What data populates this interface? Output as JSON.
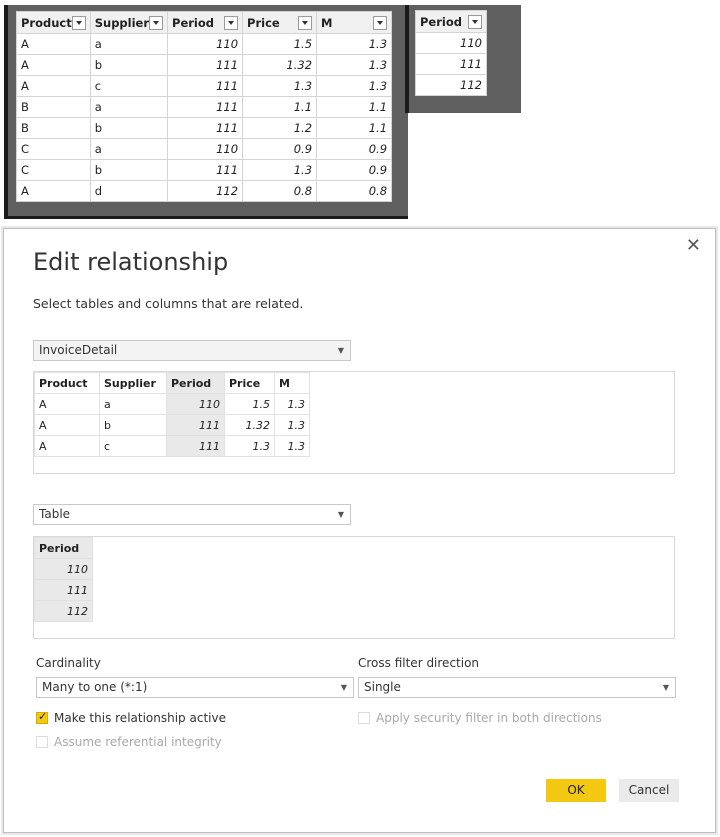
{
  "grid_left": {
    "columns": [
      "Product",
      "Supplier",
      "Period",
      "Price",
      "M"
    ],
    "rows": [
      [
        "A",
        "a",
        "110",
        "1.5",
        "1.3"
      ],
      [
        "A",
        "b",
        "111",
        "1.32",
        "1.3"
      ],
      [
        "A",
        "c",
        "111",
        "1.3",
        "1.3"
      ],
      [
        "B",
        "a",
        "111",
        "1.1",
        "1.1"
      ],
      [
        "B",
        "b",
        "111",
        "1.2",
        "1.1"
      ],
      [
        "C",
        "a",
        "110",
        "0.9",
        "0.9"
      ],
      [
        "C",
        "b",
        "111",
        "1.3",
        "0.9"
      ],
      [
        "A",
        "d",
        "112",
        "0.8",
        "0.8"
      ]
    ]
  },
  "grid_right": {
    "column": "Period",
    "rows": [
      "110",
      "111",
      "112"
    ]
  },
  "dialog": {
    "title": "Edit relationship",
    "subtitle": "Select tables and columns that are related.",
    "close_icon": "close-icon",
    "table1": {
      "selected": "InvoiceDetail",
      "columns": [
        "Product",
        "Supplier",
        "Period",
        "Price",
        "M"
      ],
      "rows": [
        [
          "A",
          "a",
          "110",
          "1.5",
          "1.3"
        ],
        [
          "A",
          "b",
          "111",
          "1.32",
          "1.3"
        ],
        [
          "A",
          "c",
          "111",
          "1.3",
          "1.3"
        ]
      ]
    },
    "table2": {
      "selected": "Table",
      "column": "Period",
      "rows": [
        "110",
        "111",
        "112"
      ]
    },
    "cardinality": {
      "label": "Cardinality",
      "value": "Many to one (*:1)"
    },
    "cross_filter": {
      "label": "Cross filter direction",
      "value": "Single"
    },
    "make_active": {
      "label": "Make this relationship active",
      "checked": true
    },
    "referential": {
      "label": "Assume referential integrity",
      "checked": false
    },
    "security": {
      "label": "Apply security filter in both directions",
      "checked": false
    },
    "ok_label": "OK",
    "cancel_label": "Cancel",
    "accent_color": "#f2c811"
  }
}
